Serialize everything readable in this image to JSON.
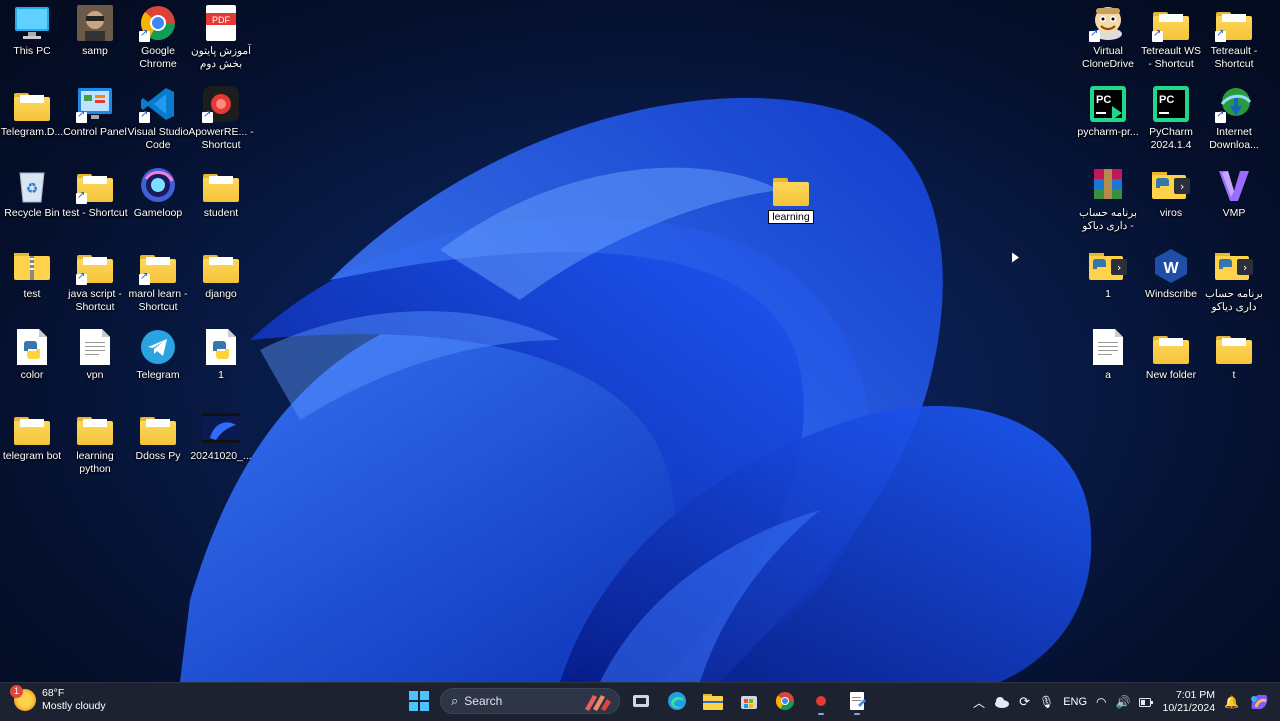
{
  "desktop": {
    "left_icons": [
      {
        "label": "This PC",
        "kind": "monitor"
      },
      {
        "label": "samp",
        "kind": "photo"
      },
      {
        "label": "Google Chrome",
        "kind": "chrome",
        "shortcut": true
      },
      {
        "label": "آموزش پایتون بخش دوم",
        "kind": "pdf"
      },
      {
        "label": "Telegram.D...",
        "kind": "folder"
      },
      {
        "label": "Control Panel",
        "kind": "control",
        "shortcut": true
      },
      {
        "label": "Visual Studio Code",
        "kind": "vscode",
        "shortcut": true
      },
      {
        "label": "ApowerRE... - Shortcut",
        "kind": "record",
        "shortcut": true
      },
      {
        "label": "Recycle Bin",
        "kind": "recycle"
      },
      {
        "label": "test - Shortcut",
        "kind": "folder",
        "shortcut": true
      },
      {
        "label": "Gameloop",
        "kind": "gameloop"
      },
      {
        "label": "student",
        "kind": "folder"
      },
      {
        "label": "test",
        "kind": "zip"
      },
      {
        "label": "java script - Shortcut",
        "kind": "folder",
        "shortcut": true
      },
      {
        "label": "marol learn - Shortcut",
        "kind": "folder",
        "shortcut": true
      },
      {
        "label": "django",
        "kind": "folder"
      },
      {
        "label": "color",
        "kind": "python"
      },
      {
        "label": "vpn",
        "kind": "doc"
      },
      {
        "label": "Telegram",
        "kind": "telegram"
      },
      {
        "label": "1",
        "kind": "python"
      },
      {
        "label": "telegram bot",
        "kind": "folder"
      },
      {
        "label": "learning python",
        "kind": "folder"
      },
      {
        "label": "Ddoss Py",
        "kind": "folder"
      },
      {
        "label": "20241020_...",
        "kind": "video"
      }
    ],
    "right_icons": [
      {
        "label": "Virtual CloneDrive",
        "kind": "clone",
        "shortcut": true
      },
      {
        "label": "Tetreault WS - Shortcut",
        "kind": "folder",
        "shortcut": true
      },
      {
        "label": "Tetreault - Shortcut",
        "kind": "folder",
        "shortcut": true
      },
      {
        "label": "pycharm-pr...",
        "kind": "pycharm-green"
      },
      {
        "label": "PyCharm 2024.1.4",
        "kind": "pycharm"
      },
      {
        "label": "Internet Downloa...",
        "kind": "idm",
        "shortcut": true
      },
      {
        "label": "برنامه حساب داری دیاکو -",
        "kind": "winrar"
      },
      {
        "label": "viros",
        "kind": "pyfolder"
      },
      {
        "label": "VMP",
        "kind": "vmp"
      },
      {
        "label": "1",
        "kind": "pyfolder"
      },
      {
        "label": "Windscribe",
        "kind": "windscribe"
      },
      {
        "label": "برنامه حساب داری دیاکو",
        "kind": "pyfolder"
      },
      {
        "label": "a",
        "kind": "doc"
      },
      {
        "label": "New folder",
        "kind": "folder"
      },
      {
        "label": "t",
        "kind": "folder"
      }
    ],
    "floating_folder": {
      "label": "learning"
    }
  },
  "taskbar": {
    "weather": {
      "temp": "68°F",
      "desc": "Mostly cloudy",
      "badge": "1"
    },
    "search_label": "Search",
    "tray": {
      "lang": "ENG",
      "time": "7:01 PM",
      "date": "10/21/2024"
    }
  }
}
